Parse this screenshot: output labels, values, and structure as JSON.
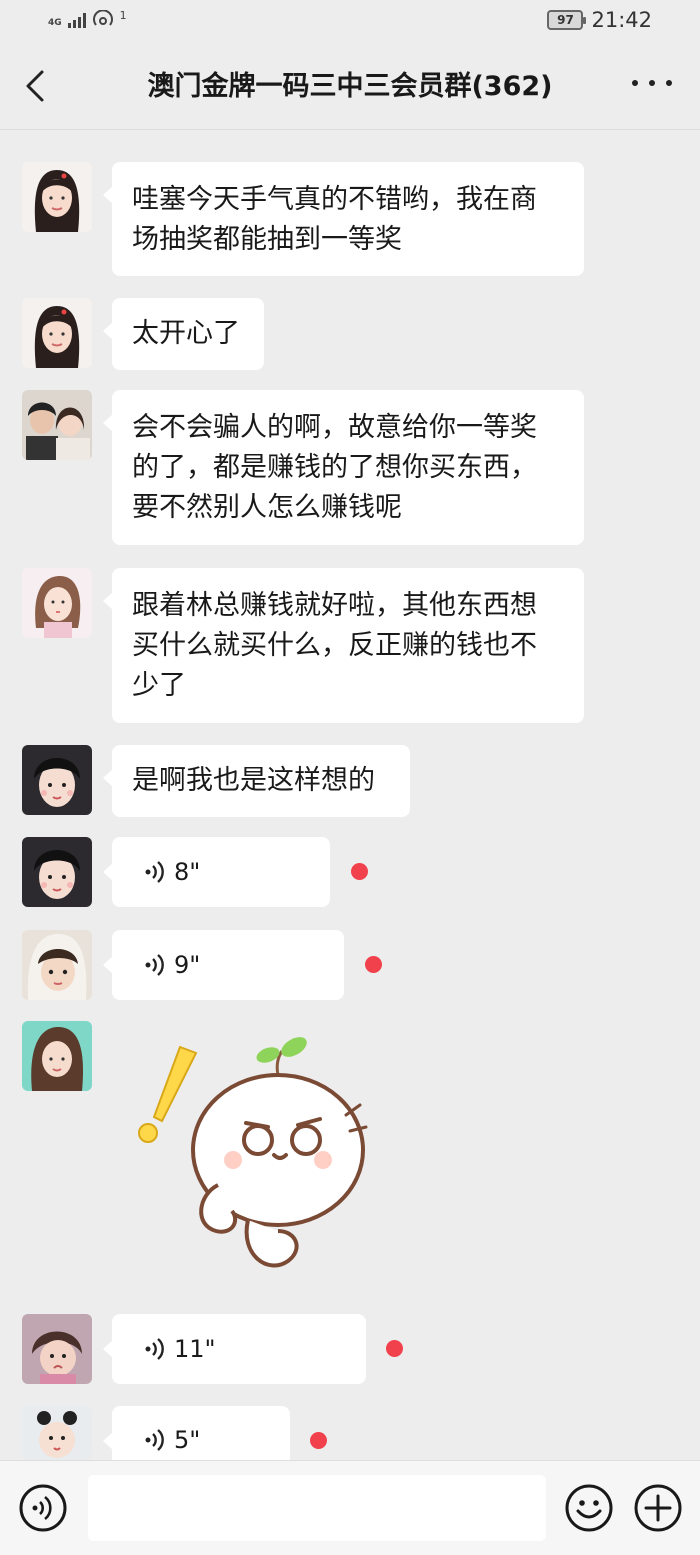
{
  "status_bar": {
    "network": "4G",
    "wifi_sup": "1",
    "battery": "97",
    "time": "21:42"
  },
  "nav": {
    "back_icon": "chevron-left-icon",
    "title": "澳门金牌一码三中三会员群(362)",
    "more_icon": "more-dots-icon"
  },
  "messages": [
    {
      "type": "text",
      "lines": [
        "哇塞今天手气真的不错哟，我在商",
        "场抽奖都能抽到一等奖"
      ]
    },
    {
      "type": "text",
      "lines": [
        "太开心了"
      ]
    },
    {
      "type": "text",
      "lines": [
        "会不会骗人的啊，故意给你一等奖",
        "的了，都是赚钱的了想你买东西，",
        "要不然别人怎么赚钱呢"
      ]
    },
    {
      "type": "text",
      "lines": [
        "跟着林总赚钱就好啦，其他东西想",
        "买什么就买什么，反正赚的钱也不",
        "少了"
      ]
    },
    {
      "type": "text",
      "lines": [
        "是啊我也是这样想的"
      ]
    },
    {
      "type": "voice",
      "duration": "8\"",
      "unread": true
    },
    {
      "type": "voice",
      "duration": "9\"",
      "unread": true
    },
    {
      "type": "sticker",
      "sticker": "cartoon-exclamation-sticker"
    },
    {
      "type": "voice",
      "duration": "11\"",
      "unread": true
    },
    {
      "type": "voice",
      "duration": "5\"",
      "unread": true
    }
  ],
  "input_bar": {
    "voice_icon": "voice-mode-icon",
    "placeholder": "",
    "emoji_icon": "emoji-icon",
    "plus_icon": "plus-icon"
  },
  "colors": {
    "background": "#ededed",
    "bubble": "#ffffff",
    "unread_dot": "#f0414c"
  }
}
